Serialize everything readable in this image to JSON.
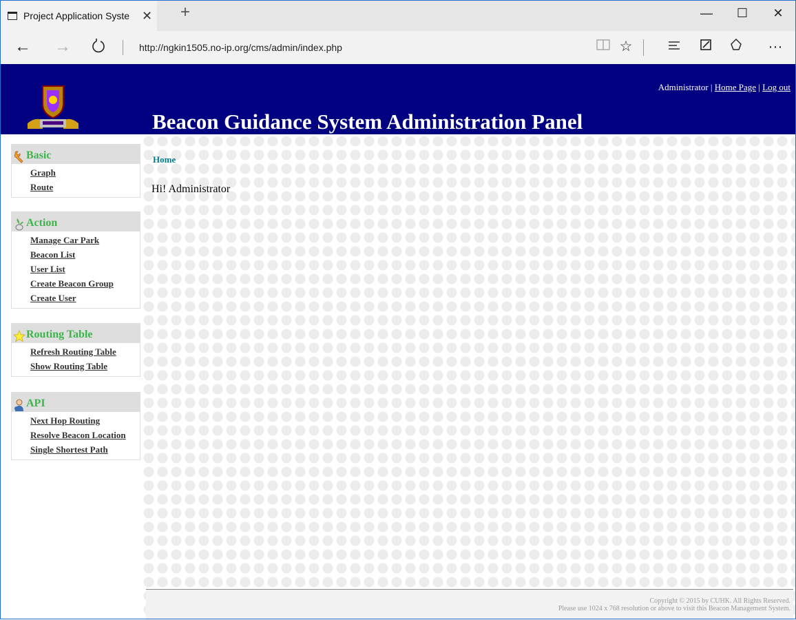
{
  "browser": {
    "tab_title": "Project Application Syste",
    "tab_close": "✕",
    "new_tab": "+",
    "window_controls": {
      "minimize": "—",
      "maximize": "☐",
      "close": "✕"
    },
    "url": "http://ngkin1505.no-ip.org/cms/admin/index.php",
    "icons": [
      "back-icon",
      "forward-icon",
      "refresh-icon",
      "reading-view-icon",
      "favorite-star-icon",
      "hub-icon",
      "web-note-icon",
      "share-icon",
      "more-icon"
    ]
  },
  "header": {
    "title": "Beacon Guidance System Administration Panel",
    "user": "Administrator",
    "separator": "|",
    "home_link": "Home Page",
    "logout_link": "Log out",
    "background": "#000080"
  },
  "sidebar": {
    "sections": [
      {
        "title": "Basic",
        "icon": "wrench-icon",
        "items": [
          "Graph",
          "Route"
        ]
      },
      {
        "title": "Action",
        "icon": "plant-icon",
        "items": [
          "Manage Car Park",
          "Beacon List",
          "User List",
          "Create Beacon Group",
          "Create User"
        ]
      },
      {
        "title": "Routing Table",
        "icon": "star-icon",
        "items": [
          "Refresh Routing Table",
          "Show Routing Table"
        ]
      },
      {
        "title": "API",
        "icon": "user-icon",
        "items": [
          "Next Hop Routing",
          "Resolve Beacon Location",
          "Single Shortest Path"
        ]
      }
    ],
    "heading_color": "#3cb54a"
  },
  "main": {
    "breadcrumb": "Home",
    "greeting": "Hi! Administrator"
  },
  "footer": {
    "line1": "Copyright © 2015 by CUHK. All Rights Reserved.",
    "line2": "Please use 1024 x 768 resolution or above to visit this Beacon Management System."
  }
}
